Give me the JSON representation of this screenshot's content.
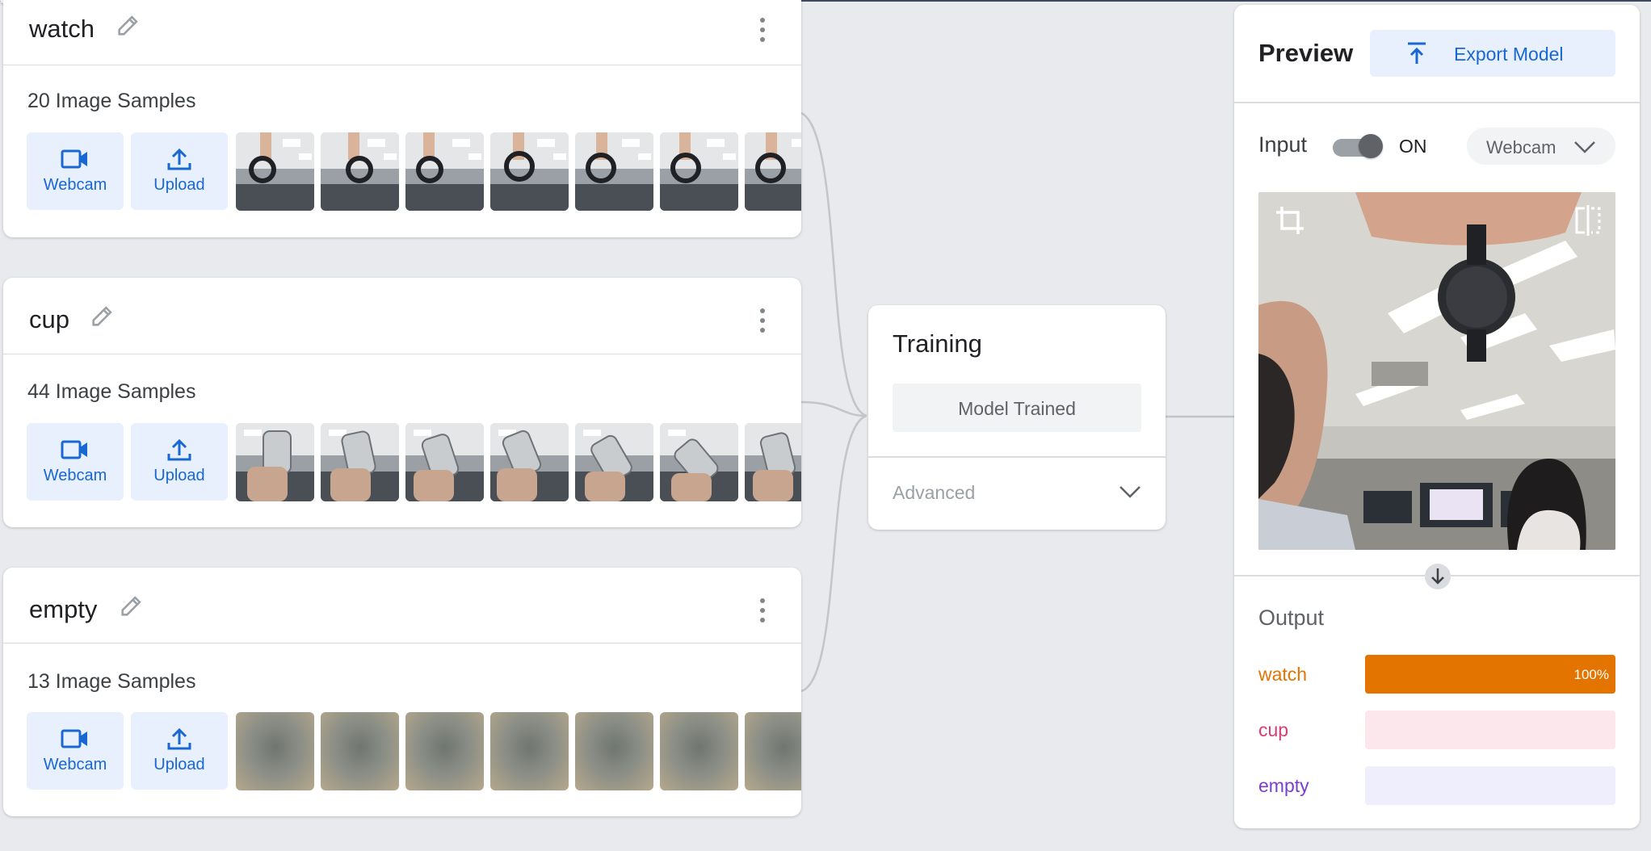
{
  "classes": [
    {
      "name": "watch",
      "samples_label": "20 Image Samples",
      "webcam_label": "Webcam",
      "upload_label": "Upload"
    },
    {
      "name": "cup",
      "samples_label": "44 Image Samples",
      "webcam_label": "Webcam",
      "upload_label": "Upload"
    },
    {
      "name": "empty",
      "samples_label": "13 Image Samples",
      "webcam_label": "Webcam",
      "upload_label": "Upload"
    }
  ],
  "training": {
    "title": "Training",
    "status_button": "Model Trained",
    "advanced_label": "Advanced"
  },
  "preview": {
    "title": "Preview",
    "export_label": "Export Model",
    "input_label": "Input",
    "toggle_state": "ON",
    "source_select": "Webcam",
    "output_label": "Output",
    "outputs": [
      {
        "label": "watch",
        "percent": 100,
        "percent_text": "100%",
        "color": "#e37400",
        "track": "#e37400"
      },
      {
        "label": "cup",
        "percent": 0,
        "percent_text": "",
        "color": "#d93c6e",
        "track": "#fce8ec"
      },
      {
        "label": "empty",
        "percent": 0,
        "percent_text": "",
        "color": "#7a3ed1",
        "track": "#eeeefc"
      }
    ]
  },
  "colors": {
    "accent_blue": "#1967d2",
    "tile_bg": "#e8f0fe",
    "page_bg": "#e8eaed"
  }
}
